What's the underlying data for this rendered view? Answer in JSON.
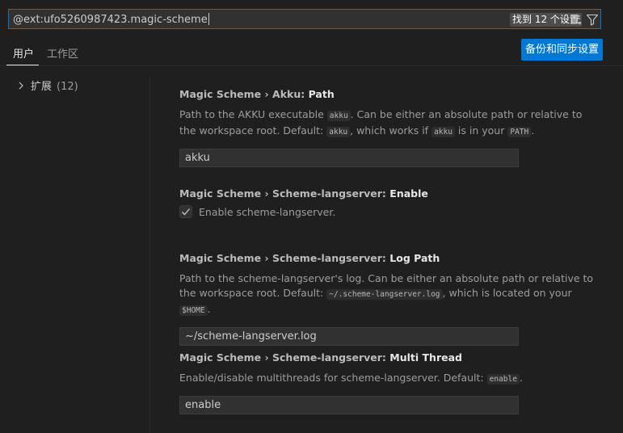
{
  "search": {
    "value": "@ext:ufo5260987423.magic-scheme",
    "result_count": "找到 12 个设置",
    "clear_filter_icon": "filter-list-icon",
    "filter_icon": "funnel-icon"
  },
  "tabs": [
    {
      "label": "用户",
      "active": true
    },
    {
      "label": "工作区",
      "active": false
    }
  ],
  "sync_button": "备份和同步设置",
  "toc": {
    "item_label": "扩展",
    "item_count": "(12)"
  },
  "settings": [
    {
      "category": "Magic Scheme › Akku: ",
      "name": "Path",
      "desc1": "Path to the AKKU executable ",
      "code1": "akku",
      "desc2": ". Can be either an absolute path or relative to the workspace root. Default: ",
      "code2": "akku",
      "desc3": ", which works if ",
      "code3": "akku",
      "desc4": " is in your ",
      "code4": "PATH",
      "desc5": ".",
      "value": "akku"
    },
    {
      "category": "Magic Scheme › Scheme-langserver: ",
      "name": "Enable",
      "checkbox_label": "Enable scheme-langserver.",
      "checked": true
    },
    {
      "category": "Magic Scheme › Scheme-langserver: ",
      "name": "Log Path",
      "desc1": "Path to the scheme-langserver's log. Can be either an absolute path or relative to the workspace root. Default: ",
      "code1": "~/.scheme-langserver.log",
      "desc2": ", which is located on your ",
      "code2": "$HOME",
      "desc3": ".",
      "value": "~/scheme-langserver.log"
    },
    {
      "category": "Magic Scheme › Scheme-langserver: ",
      "name": "Multi Thread",
      "desc1": "Enable/disable multithreads for scheme-langserver. Default: ",
      "code1": "enable",
      "desc2": ".",
      "value": "enable"
    }
  ],
  "colors": {
    "accent": "#0078d4",
    "background": "#1f1f1f",
    "input_background": "#313131"
  }
}
